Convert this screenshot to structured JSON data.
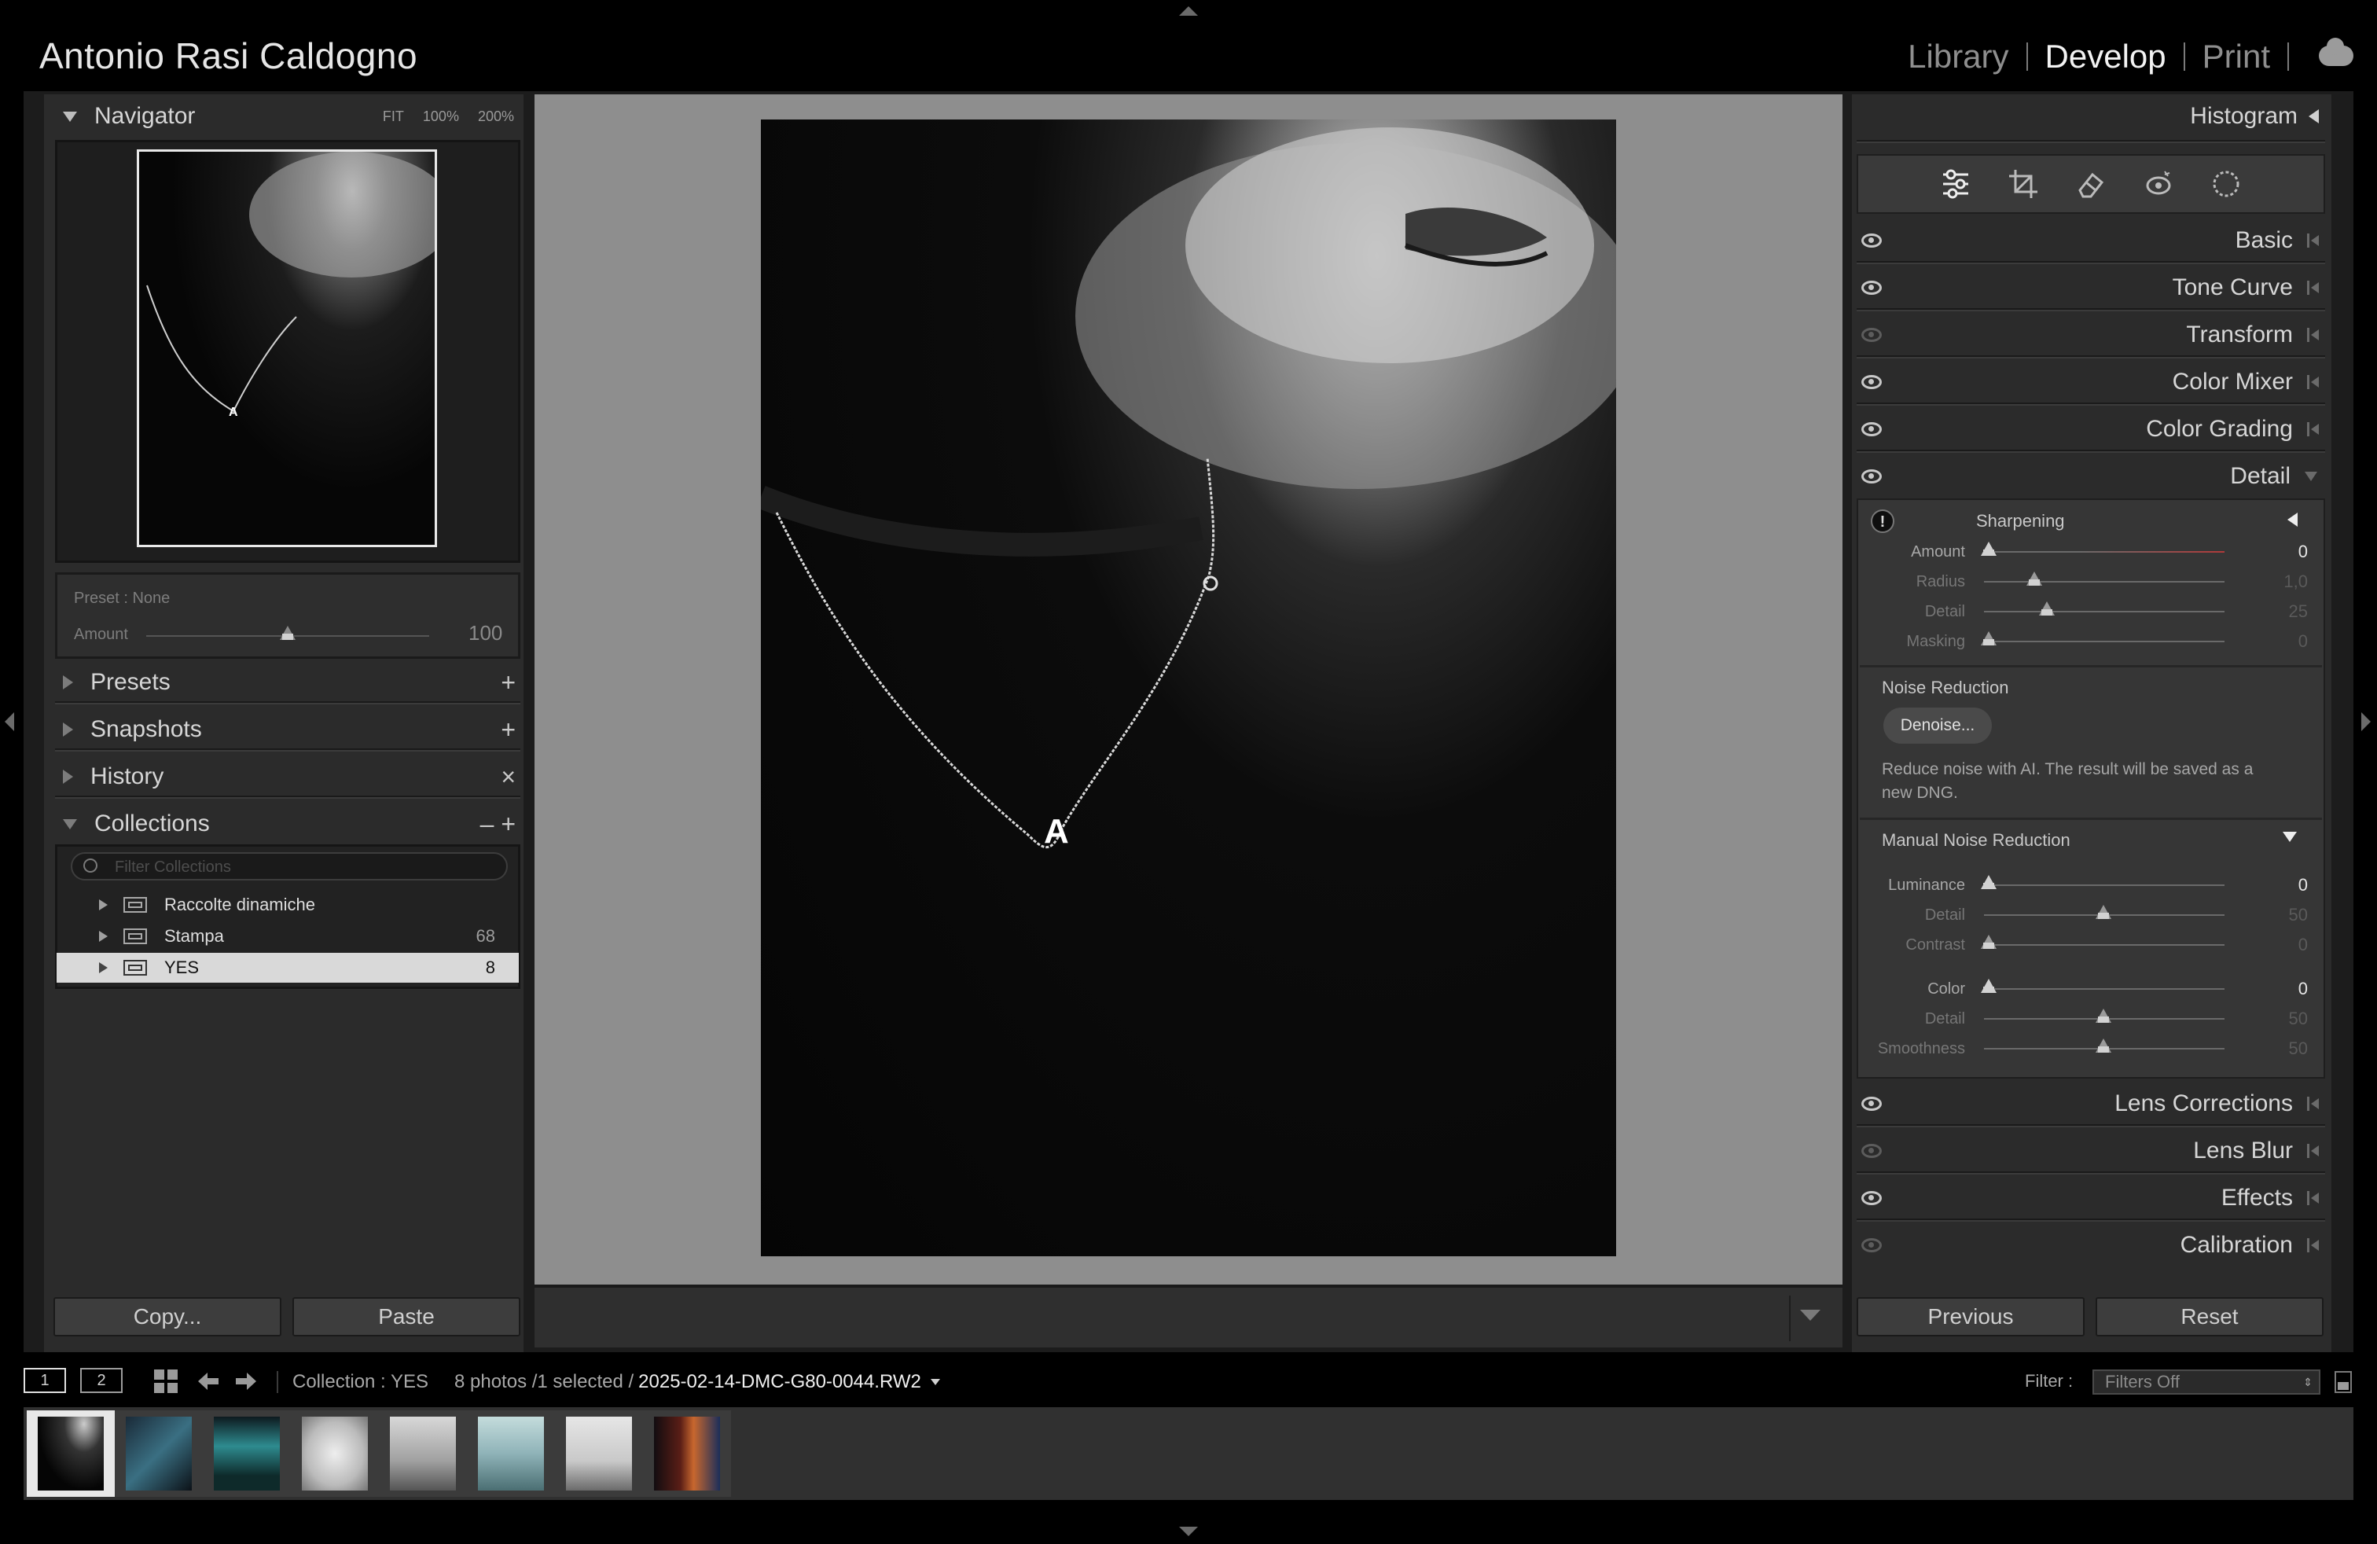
{
  "identity_plate": "Antonio Rasi Caldogno",
  "modules": [
    "Library",
    "Develop",
    "Print"
  ],
  "active_module": "Develop",
  "navigator": {
    "title": "Navigator",
    "zoom_options": [
      "FIT",
      "100%",
      "200%"
    ],
    "annotation": "A"
  },
  "preset_amount": {
    "preset_label": "Preset : None",
    "amount_label": "Amount",
    "amount_value": "100",
    "amount_fraction": 0.5
  },
  "left_sections": [
    {
      "name": "Presets",
      "action": "+"
    },
    {
      "name": "Snapshots",
      "action": "+"
    },
    {
      "name": "History",
      "action": "×"
    },
    {
      "name": "Collections",
      "action": "– +"
    }
  ],
  "collections": {
    "filter_placeholder": "Filter Collections",
    "items": [
      {
        "label": "Raccolte dinamiche",
        "count": ""
      },
      {
        "label": "Stampa",
        "count": "68"
      },
      {
        "label": "YES",
        "count": "8",
        "selected": true
      }
    ]
  },
  "left_buttons": {
    "copy": "Copy...",
    "paste": "Paste"
  },
  "histogram_title": "Histogram",
  "tools": [
    "edit-sliders",
    "crop",
    "healing",
    "red-eye",
    "masking"
  ],
  "right_sections_top": [
    {
      "name": "Basic",
      "visible": true
    },
    {
      "name": "Tone Curve",
      "visible": true
    },
    {
      "name": "Transform",
      "visible": false
    },
    {
      "name": "Color Mixer",
      "visible": true
    },
    {
      "name": "Color Grading",
      "visible": true
    },
    {
      "name": "Detail",
      "visible": true
    }
  ],
  "detail": {
    "sharpening": {
      "title": "Sharpening",
      "sliders": [
        {
          "label": "Amount",
          "value": "0",
          "fraction": 0.0,
          "active": true
        },
        {
          "label": "Radius",
          "value": "1,0",
          "fraction": 0.19,
          "active": false
        },
        {
          "label": "Detail",
          "value": "25",
          "fraction": 0.25,
          "active": false
        },
        {
          "label": "Masking",
          "value": "0",
          "fraction": 0.0,
          "active": false
        }
      ]
    },
    "noise_reduction": {
      "title": "Noise Reduction",
      "denoise_label": "Denoise...",
      "note": "Reduce noise with AI. The result will be saved as a new DNG."
    },
    "manual_noise_reduction": {
      "title": "Manual Noise Reduction",
      "sliders": [
        {
          "label": "Luminance",
          "value": "0",
          "fraction": 0.0,
          "active": true
        },
        {
          "label": "Detail",
          "value": "50",
          "fraction": 0.5,
          "active": false
        },
        {
          "label": "Contrast",
          "value": "0",
          "fraction": 0.0,
          "active": false
        },
        {
          "label": "Color",
          "value": "0",
          "fraction": 0.0,
          "active": true
        },
        {
          "label": "Detail",
          "value": "50",
          "fraction": 0.5,
          "active": false
        },
        {
          "label": "Smoothness",
          "value": "50",
          "fraction": 0.5,
          "active": false
        }
      ]
    }
  },
  "right_sections_bottom": [
    {
      "name": "Lens Corrections",
      "visible": true
    },
    {
      "name": "Lens Blur",
      "visible": false
    },
    {
      "name": "Effects",
      "visible": true
    },
    {
      "name": "Calibration",
      "visible": false
    }
  ],
  "right_buttons": {
    "previous": "Previous",
    "reset": "Reset"
  },
  "filmstrip": {
    "screen_buttons": [
      "1",
      "2"
    ],
    "collection_label": "Collection : YES",
    "count_label": "8 photos /1 selected /",
    "filename": "2025-02-14-DMC-G80-0044.RW2",
    "filter_label": "Filter :",
    "filter_value": "Filters Off"
  },
  "colors": {
    "accent_red": "#b03a3a",
    "panel": "#2b2b2b",
    "background": "#000000"
  }
}
